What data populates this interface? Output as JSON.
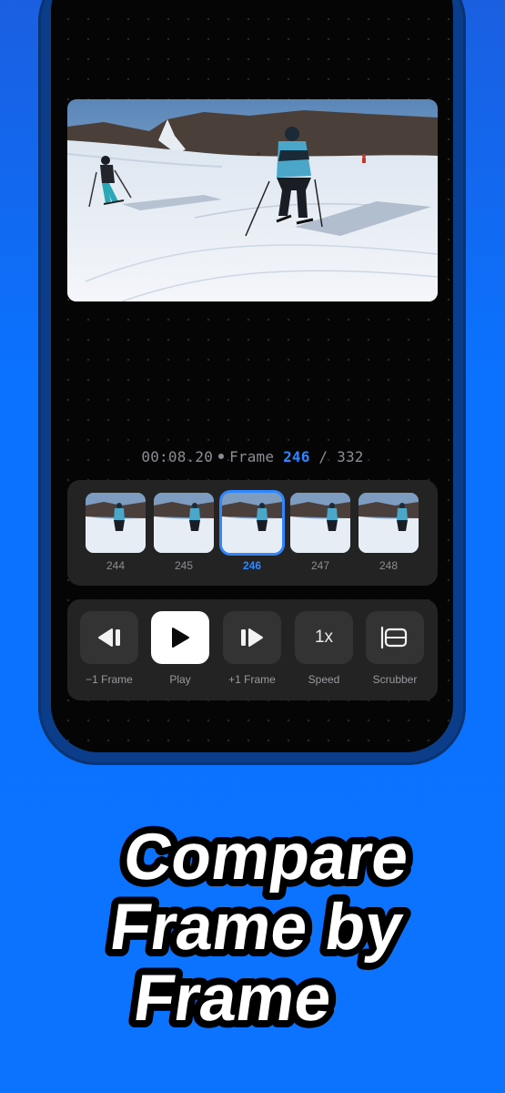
{
  "playback": {
    "timecode": "00:08.20",
    "frame_word": "Frame",
    "current_frame": "246",
    "separator": "/",
    "total_frames": "332"
  },
  "frames": [
    {
      "label": "244",
      "selected": false
    },
    {
      "label": "245",
      "selected": false
    },
    {
      "label": "246",
      "selected": true
    },
    {
      "label": "247",
      "selected": false
    },
    {
      "label": "248",
      "selected": false
    }
  ],
  "controls": [
    {
      "label": "−1 Frame",
      "icon": "step-back-icon"
    },
    {
      "label": "Play",
      "icon": "play-icon"
    },
    {
      "label": "+1 Frame",
      "icon": "step-forward-icon"
    },
    {
      "label": "Speed",
      "icon": "speed-text",
      "text": "1x"
    },
    {
      "label": "Scrubber",
      "icon": "scrubber-icon"
    }
  ],
  "headline": {
    "line1": "Compare",
    "line2": "Frame by",
    "line3": "Frame"
  },
  "colors": {
    "accent": "#2f86ff",
    "background_blue": "#0b73ff",
    "screen": "#050505",
    "panel": "#232323"
  }
}
